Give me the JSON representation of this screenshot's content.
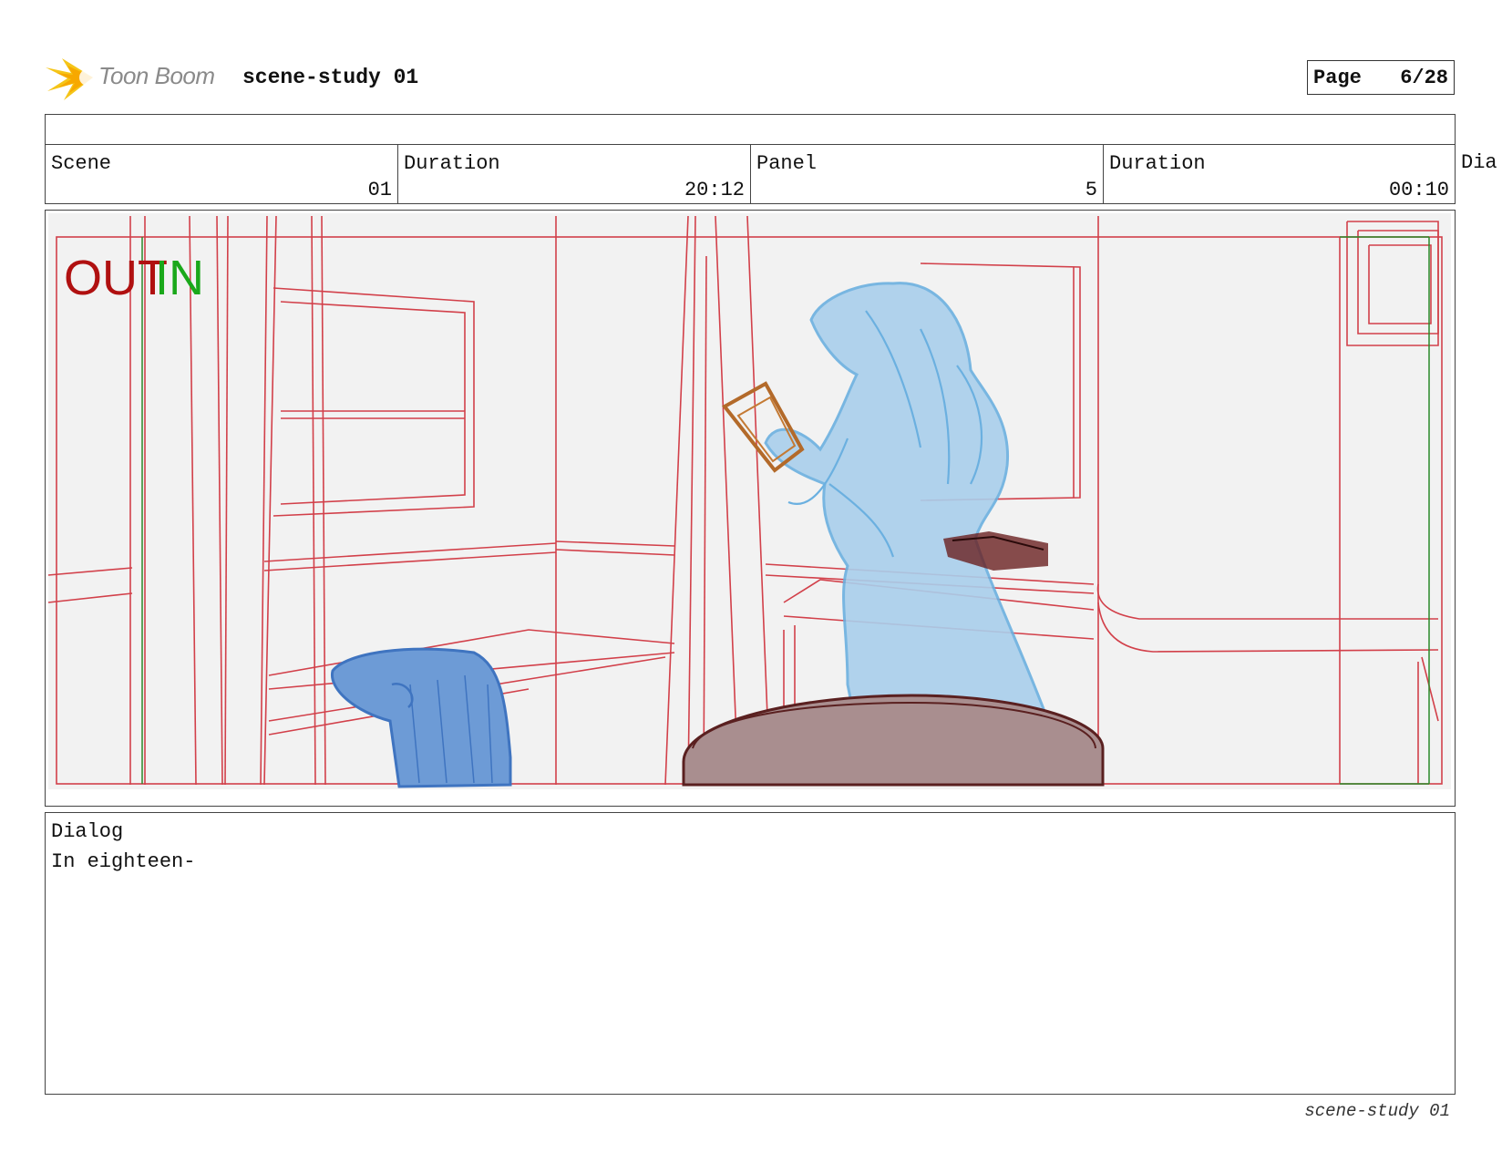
{
  "header": {
    "logo_text": "Toon Boom",
    "title": "scene-study 01",
    "page_label": "Page",
    "page_value": "6/28"
  },
  "info": {
    "scene_label": "Scene",
    "scene_value": "01",
    "scene_duration_label": "Duration",
    "scene_duration_value": "20:12",
    "panel_label": "Panel",
    "panel_value": "5",
    "panel_duration_label": "Duration",
    "panel_duration_value": "00:10",
    "dialog_cut_label": "Dia"
  },
  "panel": {
    "out_marker": "OUT",
    "in_marker": "IN",
    "out_color": "#b01010",
    "in_color": "#1aa81a",
    "layout_line_color": "#d2404a",
    "character_color": "#8fc3e8",
    "cloth_color": "#5b8ed0",
    "table_color": "#a98e8f",
    "book_color": "#b36a2a"
  },
  "dialog": {
    "label": "Dialog",
    "text": "In eighteen-"
  },
  "footer": {
    "text": "scene-study 01"
  }
}
